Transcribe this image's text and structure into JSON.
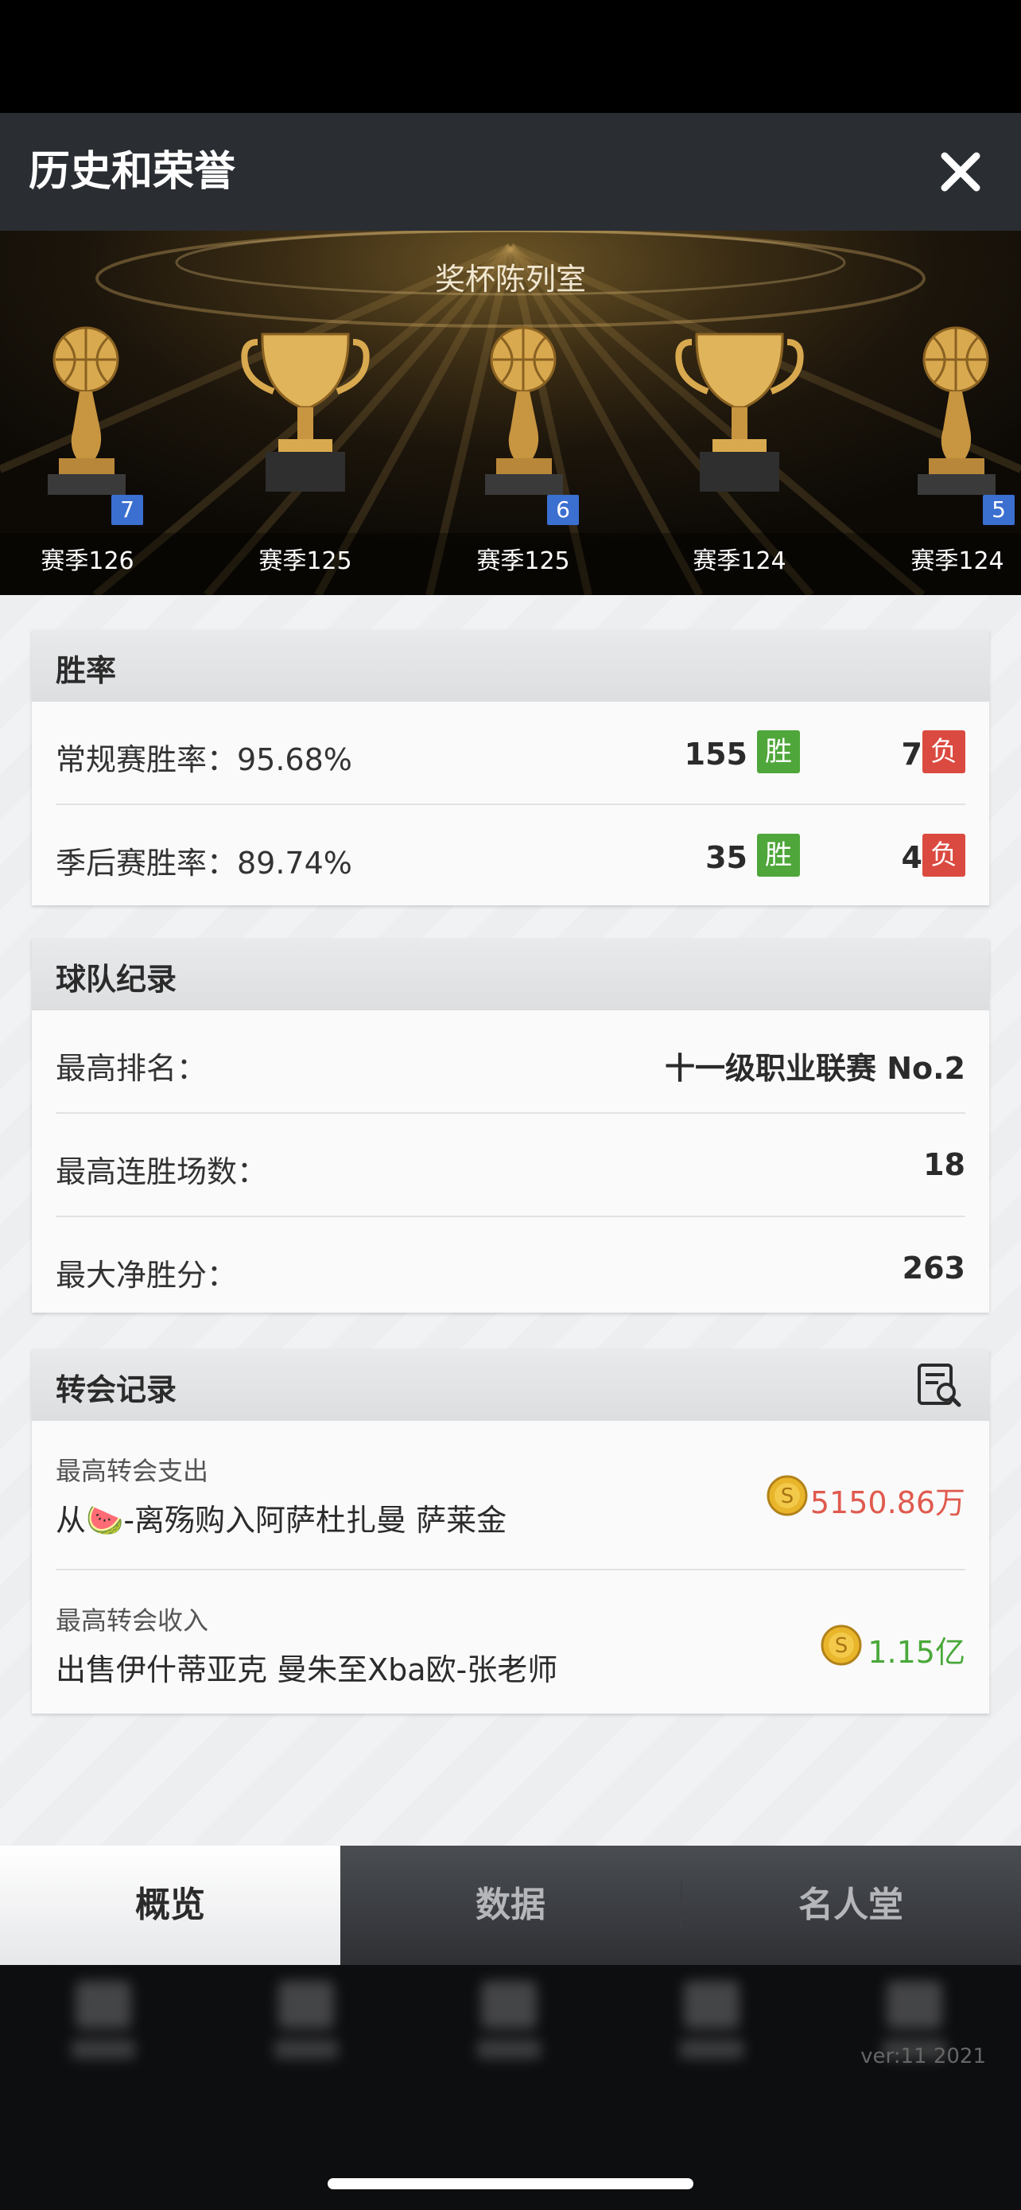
{
  "header": {
    "title": "历史和荣誉"
  },
  "banner": {
    "title": "奖杯陈列室",
    "trophies": [
      {
        "label": "赛季126",
        "type": "ball",
        "badge": "7"
      },
      {
        "label": "赛季125",
        "type": "cup",
        "badge": ""
      },
      {
        "label": "赛季125",
        "type": "ball",
        "badge": "6"
      },
      {
        "label": "赛季124",
        "type": "cup",
        "badge": ""
      },
      {
        "label": "赛季124",
        "type": "ball",
        "badge": "5"
      }
    ]
  },
  "win_rate": {
    "title": "胜率",
    "win_label": "胜",
    "lose_label": "负",
    "rows": [
      {
        "label": "常规赛胜率：95.68%",
        "wins": "155",
        "losses": "7"
      },
      {
        "label": "季后赛胜率：89.74%",
        "wins": "35",
        "losses": "4"
      }
    ]
  },
  "team_record": {
    "title": "球队纪录",
    "rows": [
      {
        "label": "最高排名：",
        "value": "十一级职业联赛 No.2"
      },
      {
        "label": "最高连胜场数：",
        "value": "18"
      },
      {
        "label": "最大净胜分：",
        "value": "263"
      }
    ]
  },
  "transfer_record": {
    "title": "转会记录",
    "rows": [
      {
        "label": "最高转会支出",
        "detail": "从🍉-离殇购入阿萨杜扎曼 萨莱金",
        "amount": "5150.86万",
        "color": "#e05a4e"
      },
      {
        "label": "最高转会收入",
        "detail": "出售伊什蒂亚克 曼朱至Xba欧-张老师",
        "amount": "1.15亿",
        "color": "#4aa83a"
      }
    ]
  },
  "tabs": [
    {
      "label": "概览",
      "active": true
    },
    {
      "label": "数据",
      "active": false
    },
    {
      "label": "名人堂",
      "active": false
    }
  ],
  "footer": {
    "version": "ver:11  2021"
  },
  "colors": {
    "win": "#4fa63a",
    "lose": "#db4a40",
    "badge": "#3b6fd0"
  }
}
